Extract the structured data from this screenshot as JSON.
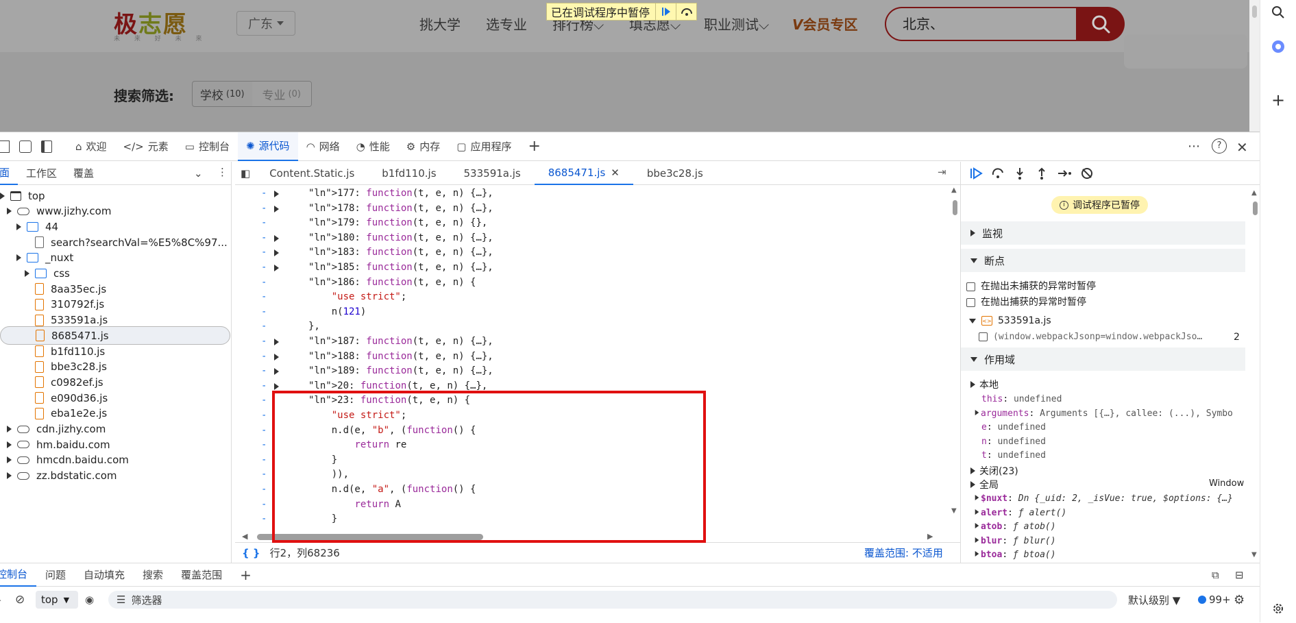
{
  "website": {
    "logo": [
      "极",
      "志",
      "愿"
    ],
    "logo_sub": "未 来 好 未 来",
    "region": "广东",
    "nav": [
      "挑大学",
      "选专业",
      "排行榜",
      "填志愿",
      "职业测试"
    ],
    "vip": "会员专区",
    "search_value": "北京、",
    "debug_banner": "已在调试程序中暂停",
    "filter_label": "搜索筛选:",
    "filter_tabs": [
      {
        "label": "学校",
        "count": "(10)"
      },
      {
        "label": "专业",
        "count": "(0)"
      }
    ]
  },
  "devtools": {
    "main_tabs": [
      "欢迎",
      "元素",
      "控制台",
      "源代码",
      "网络",
      "性能",
      "内存",
      "应用程序"
    ],
    "active_main_tab": "源代码",
    "nav_subtabs": [
      "页面",
      "工作区",
      "覆盖"
    ],
    "tree": [
      {
        "label": "top",
        "depth": 0,
        "type": "frame",
        "expand": "open"
      },
      {
        "label": "www.jizhy.com",
        "depth": 1,
        "type": "cloud",
        "expand": "open"
      },
      {
        "label": "44",
        "depth": 2,
        "type": "folder",
        "expand": "closed"
      },
      {
        "label": "search?searchVal=%E5%8C%97...",
        "depth": 3,
        "type": "file-grey",
        "expand": "none"
      },
      {
        "label": "_nuxt",
        "depth": 2,
        "type": "folder",
        "expand": "open"
      },
      {
        "label": "css",
        "depth": 3,
        "type": "folder",
        "expand": "closed"
      },
      {
        "label": "8aa35ec.js",
        "depth": 3,
        "type": "file",
        "expand": "none"
      },
      {
        "label": "310792f.js",
        "depth": 3,
        "type": "file",
        "expand": "none"
      },
      {
        "label": "533591a.js",
        "depth": 3,
        "type": "file",
        "expand": "none"
      },
      {
        "label": "8685471.js",
        "depth": 3,
        "type": "file",
        "expand": "none",
        "selected": true
      },
      {
        "label": "b1fd110.js",
        "depth": 3,
        "type": "file",
        "expand": "none"
      },
      {
        "label": "bbe3c28.js",
        "depth": 3,
        "type": "file",
        "expand": "none"
      },
      {
        "label": "c0982ef.js",
        "depth": 3,
        "type": "file",
        "expand": "none"
      },
      {
        "label": "e090d36.js",
        "depth": 3,
        "type": "file",
        "expand": "none"
      },
      {
        "label": "eba1e2e.js",
        "depth": 3,
        "type": "file",
        "expand": "none"
      },
      {
        "label": "cdn.jizhy.com",
        "depth": 1,
        "type": "cloud",
        "expand": "closed"
      },
      {
        "label": "hm.baidu.com",
        "depth": 1,
        "type": "cloud",
        "expand": "closed"
      },
      {
        "label": "hmcdn.baidu.com",
        "depth": 1,
        "type": "cloud",
        "expand": "closed"
      },
      {
        "label": "zz.bdstatic.com",
        "depth": 1,
        "type": "cloud",
        "expand": "closed"
      }
    ],
    "file_tabs": [
      "Content.Static.js",
      "b1fd110.js",
      "533591a.js",
      "8685471.js",
      "bbe3c28.js"
    ],
    "active_file_tab": "8685471.js",
    "code_lines": [
      {
        "fold": true,
        "text": "177: function(t, e, n) {…},"
      },
      {
        "fold": true,
        "text": "178: function(t, e, n) {…},"
      },
      {
        "fold": false,
        "text": "179: function(t, e, n) {},"
      },
      {
        "fold": true,
        "text": "180: function(t, e, n) {…},"
      },
      {
        "fold": true,
        "text": "183: function(t, e, n) {…},"
      },
      {
        "fold": true,
        "text": "185: function(t, e, n) {…},"
      },
      {
        "fold": false,
        "text": "186: function(t, e, n) {"
      },
      {
        "fold": false,
        "text": "    \"use strict\";"
      },
      {
        "fold": false,
        "text": "    n(121)"
      },
      {
        "fold": false,
        "text": "},"
      },
      {
        "fold": true,
        "text": "187: function(t, e, n) {…},"
      },
      {
        "fold": true,
        "text": "188: function(t, e, n) {…},"
      },
      {
        "fold": true,
        "text": "189: function(t, e, n) {…},"
      },
      {
        "fold": true,
        "text": "20: function(t, e, n) {…},"
      },
      {
        "fold": false,
        "text": "23: function(t, e, n) {"
      },
      {
        "fold": false,
        "text": "    \"use strict\";"
      },
      {
        "fold": false,
        "text": "    n.d(e, \"b\", (function() {"
      },
      {
        "fold": false,
        "text": "        return re"
      },
      {
        "fold": false,
        "text": "    }"
      },
      {
        "fold": false,
        "text": "    )),"
      },
      {
        "fold": false,
        "text": "    n.d(e, \"a\", (function() {"
      },
      {
        "fold": false,
        "text": "        return A"
      },
      {
        "fold": false,
        "text": "    }"
      }
    ],
    "status_position": "行2，列68236",
    "status_coverage": "覆盖范围: 不适用",
    "debugger": {
      "paused_label": "调试程序已暂停",
      "sections": {
        "watch": "监视",
        "breakpoints": "断点",
        "scope": "作用域"
      },
      "pause_uncaught": "在抛出未捕获的异常时暂停",
      "pause_caught": "在抛出捕获的异常时暂停",
      "bp_file": "533591a.js",
      "bp_code": "(window.webpackJsonp=window.webpackJso…",
      "bp_line": "2",
      "scope_local": "本地",
      "scope_vars": [
        {
          "name": "this",
          "value": "undefined",
          "expand": false
        },
        {
          "name": "arguments",
          "value": "Arguments [{…}, callee: (...), Symbo",
          "expand": true
        },
        {
          "name": "e",
          "value": "undefined",
          "expand": false
        },
        {
          "name": "n",
          "value": "undefined",
          "expand": false
        },
        {
          "name": "t",
          "value": "undefined",
          "expand": false
        }
      ],
      "closure": "关闭(23)",
      "global": "全局",
      "global_value": "Window",
      "global_vars": [
        {
          "name": "$nuxt",
          "value": "Dn {_uid: 2, _isVue: true, $options: {…}"
        },
        {
          "name": "alert",
          "value": "ƒ alert()"
        },
        {
          "name": "atob",
          "value": "ƒ atob()"
        },
        {
          "name": "blur",
          "value": "ƒ blur()"
        },
        {
          "name": "btoa",
          "value": "ƒ btoa()"
        }
      ]
    },
    "drawer_tabs": [
      "控制台",
      "问题",
      "自动填充",
      "搜索",
      "覆盖范围"
    ],
    "console_context": "top",
    "filter_placeholder": "筛选器",
    "log_level": "默认级别",
    "issues_count": "99+"
  }
}
